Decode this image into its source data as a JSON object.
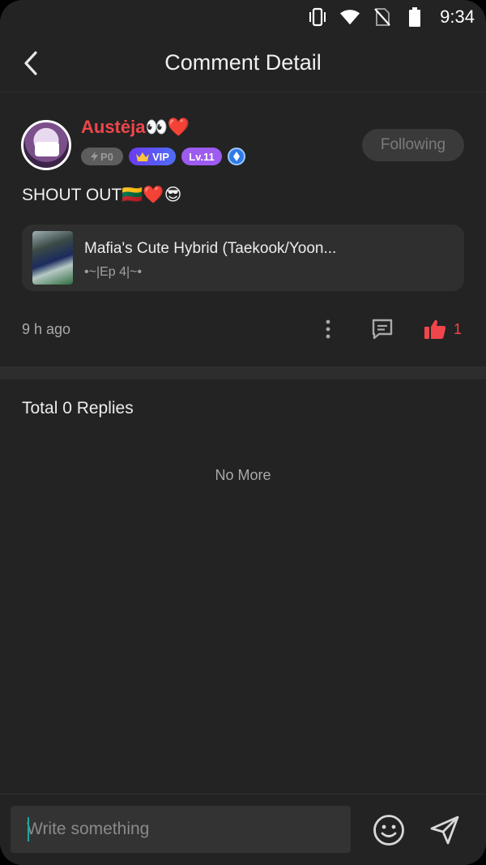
{
  "status_bar": {
    "time": "9:34",
    "icons": [
      "vibrate-icon",
      "wifi-icon",
      "no-sim-icon",
      "battery-icon"
    ]
  },
  "header": {
    "title": "Comment Detail",
    "back_icon": "chevron-left-icon"
  },
  "comment": {
    "username": "Austėja👀❤️",
    "badges": {
      "points": "P0",
      "vip": "VIP",
      "level": "Lv.11"
    },
    "follow_label": "Following",
    "text": "SHOUT OUT🇱🇹❤️😎",
    "story": {
      "title": "Mafia's Cute Hybrid (Taekook/Yoon...",
      "subtitle": "•~|Ep 4|~•"
    },
    "time_ago": "9 h ago",
    "like_count": "1"
  },
  "replies": {
    "title": "Total 0 Replies",
    "empty_text": "No More"
  },
  "composer": {
    "placeholder": "Write something"
  },
  "colors": {
    "background": "#232323",
    "accent_red": "#f0464b",
    "vip": "#6a3cf0",
    "level": "#9d5bf0"
  }
}
